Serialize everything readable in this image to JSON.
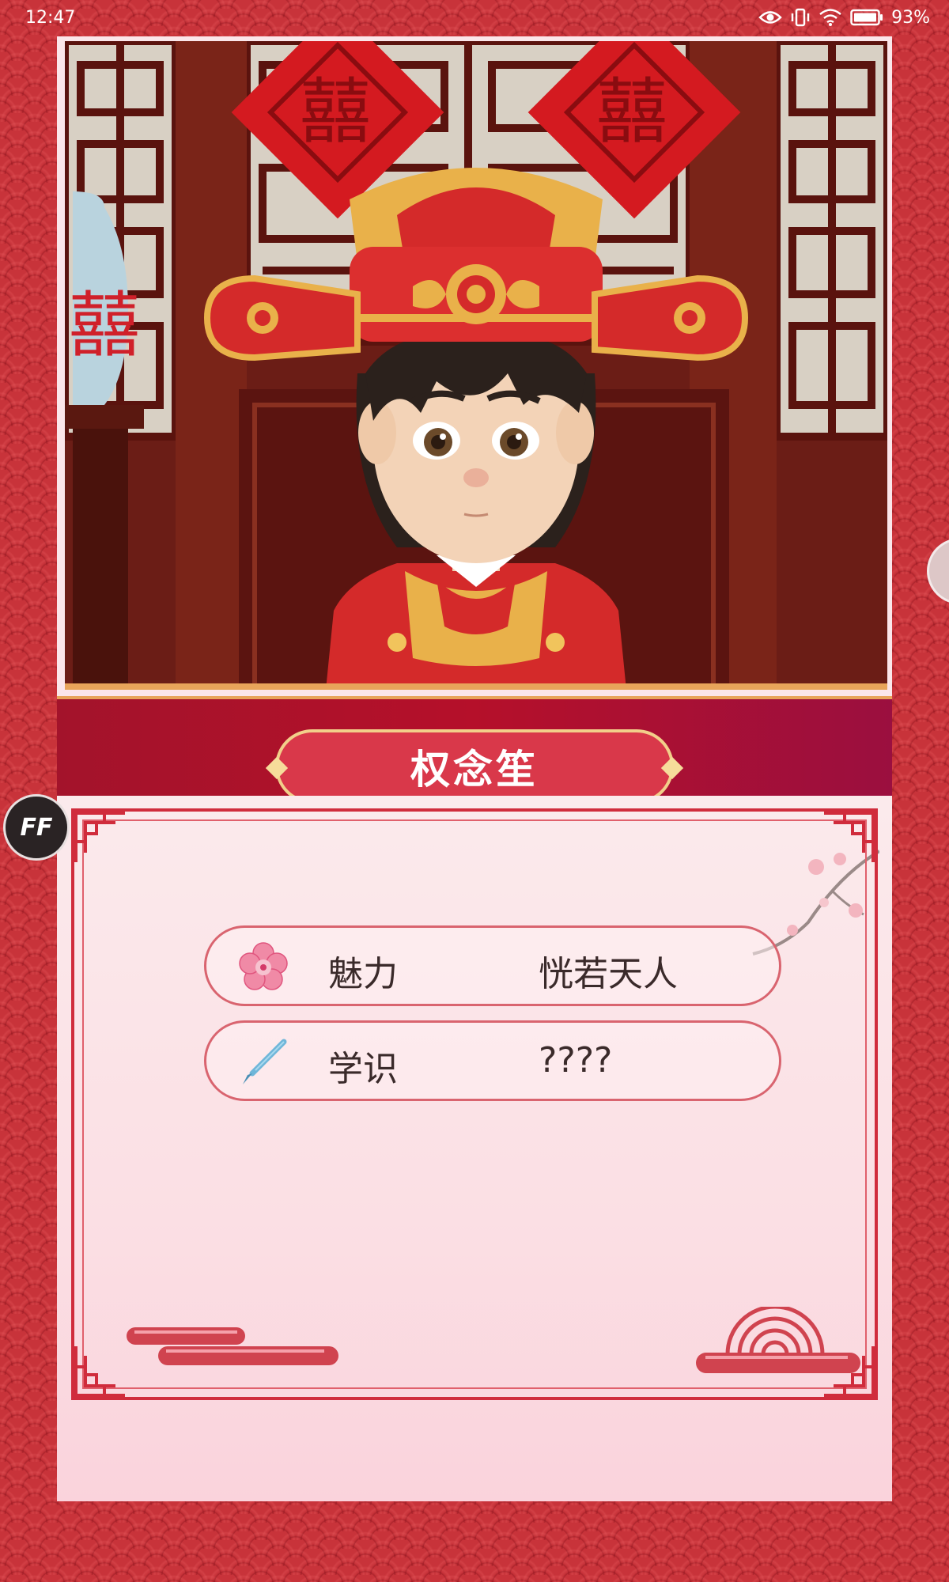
{
  "status_bar": {
    "time": "12:47",
    "battery": "93%",
    "icons": [
      "eye-icon",
      "vibrate-icon",
      "wifi-icon",
      "battery-icon"
    ]
  },
  "character": {
    "name": "权念笙"
  },
  "stats": [
    {
      "icon": "plum-blossom-icon",
      "label": "魅力",
      "value": "恍若天人"
    },
    {
      "icon": "writing-brush-icon",
      "label": "学识",
      "value": "????"
    }
  ],
  "floating": {
    "ff_badge": "FF"
  },
  "colors": {
    "background": "#c8333a",
    "name_band": "#b5102a",
    "name_plate": "#d9384a",
    "frame": "#d02c3c",
    "panel": "#fbe6ea"
  }
}
